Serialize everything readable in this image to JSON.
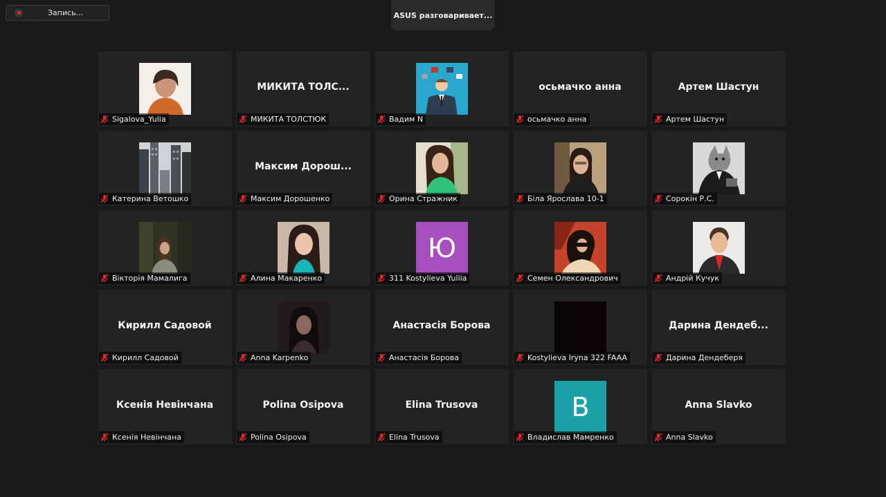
{
  "recording": {
    "label": "Запись...",
    "icon": "record-icon",
    "color": "#e02828"
  },
  "speaker": {
    "text": "ASUS разговаривает..."
  },
  "colors": {
    "background": "#1a1a1a",
    "tile": "#232323",
    "mute_red": "#e02828"
  },
  "participants": [
    {
      "name": "Sigalova_Yulia",
      "avatar": "photo"
    },
    {
      "name": "МИКИТА ТОЛСТЮК",
      "display": "МИКИТА  ТОЛС...",
      "avatar": "none"
    },
    {
      "name": "Вадим N",
      "avatar": "photo"
    },
    {
      "name": "осьмачко анна",
      "display": "осьмачко анна",
      "avatar": "none"
    },
    {
      "name": "Артем Шастун",
      "display": "Артем Шастун",
      "avatar": "none"
    },
    {
      "name": "Катерина Ветошко",
      "avatar": "photo"
    },
    {
      "name": "Максим Дорошенко",
      "display": "Максим  Дорош...",
      "avatar": "none"
    },
    {
      "name": "Орина Стражник",
      "avatar": "photo"
    },
    {
      "name": "Біла Ярослава 10-1",
      "avatar": "photo"
    },
    {
      "name": "Сорокін Р.С.",
      "avatar": "photo"
    },
    {
      "name": "Вікторія Мамалига",
      "avatar": "photo"
    },
    {
      "name": "Алина Макаренко",
      "avatar": "photo"
    },
    {
      "name": "311 Kostylieva Yuliia",
      "avatar": "letter",
      "letter": "Ю",
      "color": "#a84fc0"
    },
    {
      "name": "Семен Олександрович",
      "avatar": "photo"
    },
    {
      "name": "Андрій Кучук",
      "avatar": "photo"
    },
    {
      "name": "Кирилл Садовой",
      "display": "Кирилл Садовой",
      "avatar": "none"
    },
    {
      "name": "Anna Karpenko",
      "avatar": "photo"
    },
    {
      "name": "Анастасія Борова",
      "display": "Анастасія Борова",
      "avatar": "none"
    },
    {
      "name": "Kostylieva Iryna 322 FAAA",
      "avatar": "photo"
    },
    {
      "name": "Дарина Дендеберя",
      "display": "Дарина  Дендеб...",
      "avatar": "none"
    },
    {
      "name": "Ксенія Невінчана",
      "display": "Ксенія Невінчана",
      "avatar": "none"
    },
    {
      "name": "Polina Osipova",
      "display": "Polina Osipova",
      "avatar": "none"
    },
    {
      "name": "Elina Trusova",
      "display": "Elina Trusova",
      "avatar": "none"
    },
    {
      "name": "Владислав Мамренко",
      "avatar": "letter",
      "letter": "В",
      "color": "#1da1a8"
    },
    {
      "name": "Anna Slavko",
      "display": "Anna Slavko",
      "avatar": "none"
    }
  ]
}
